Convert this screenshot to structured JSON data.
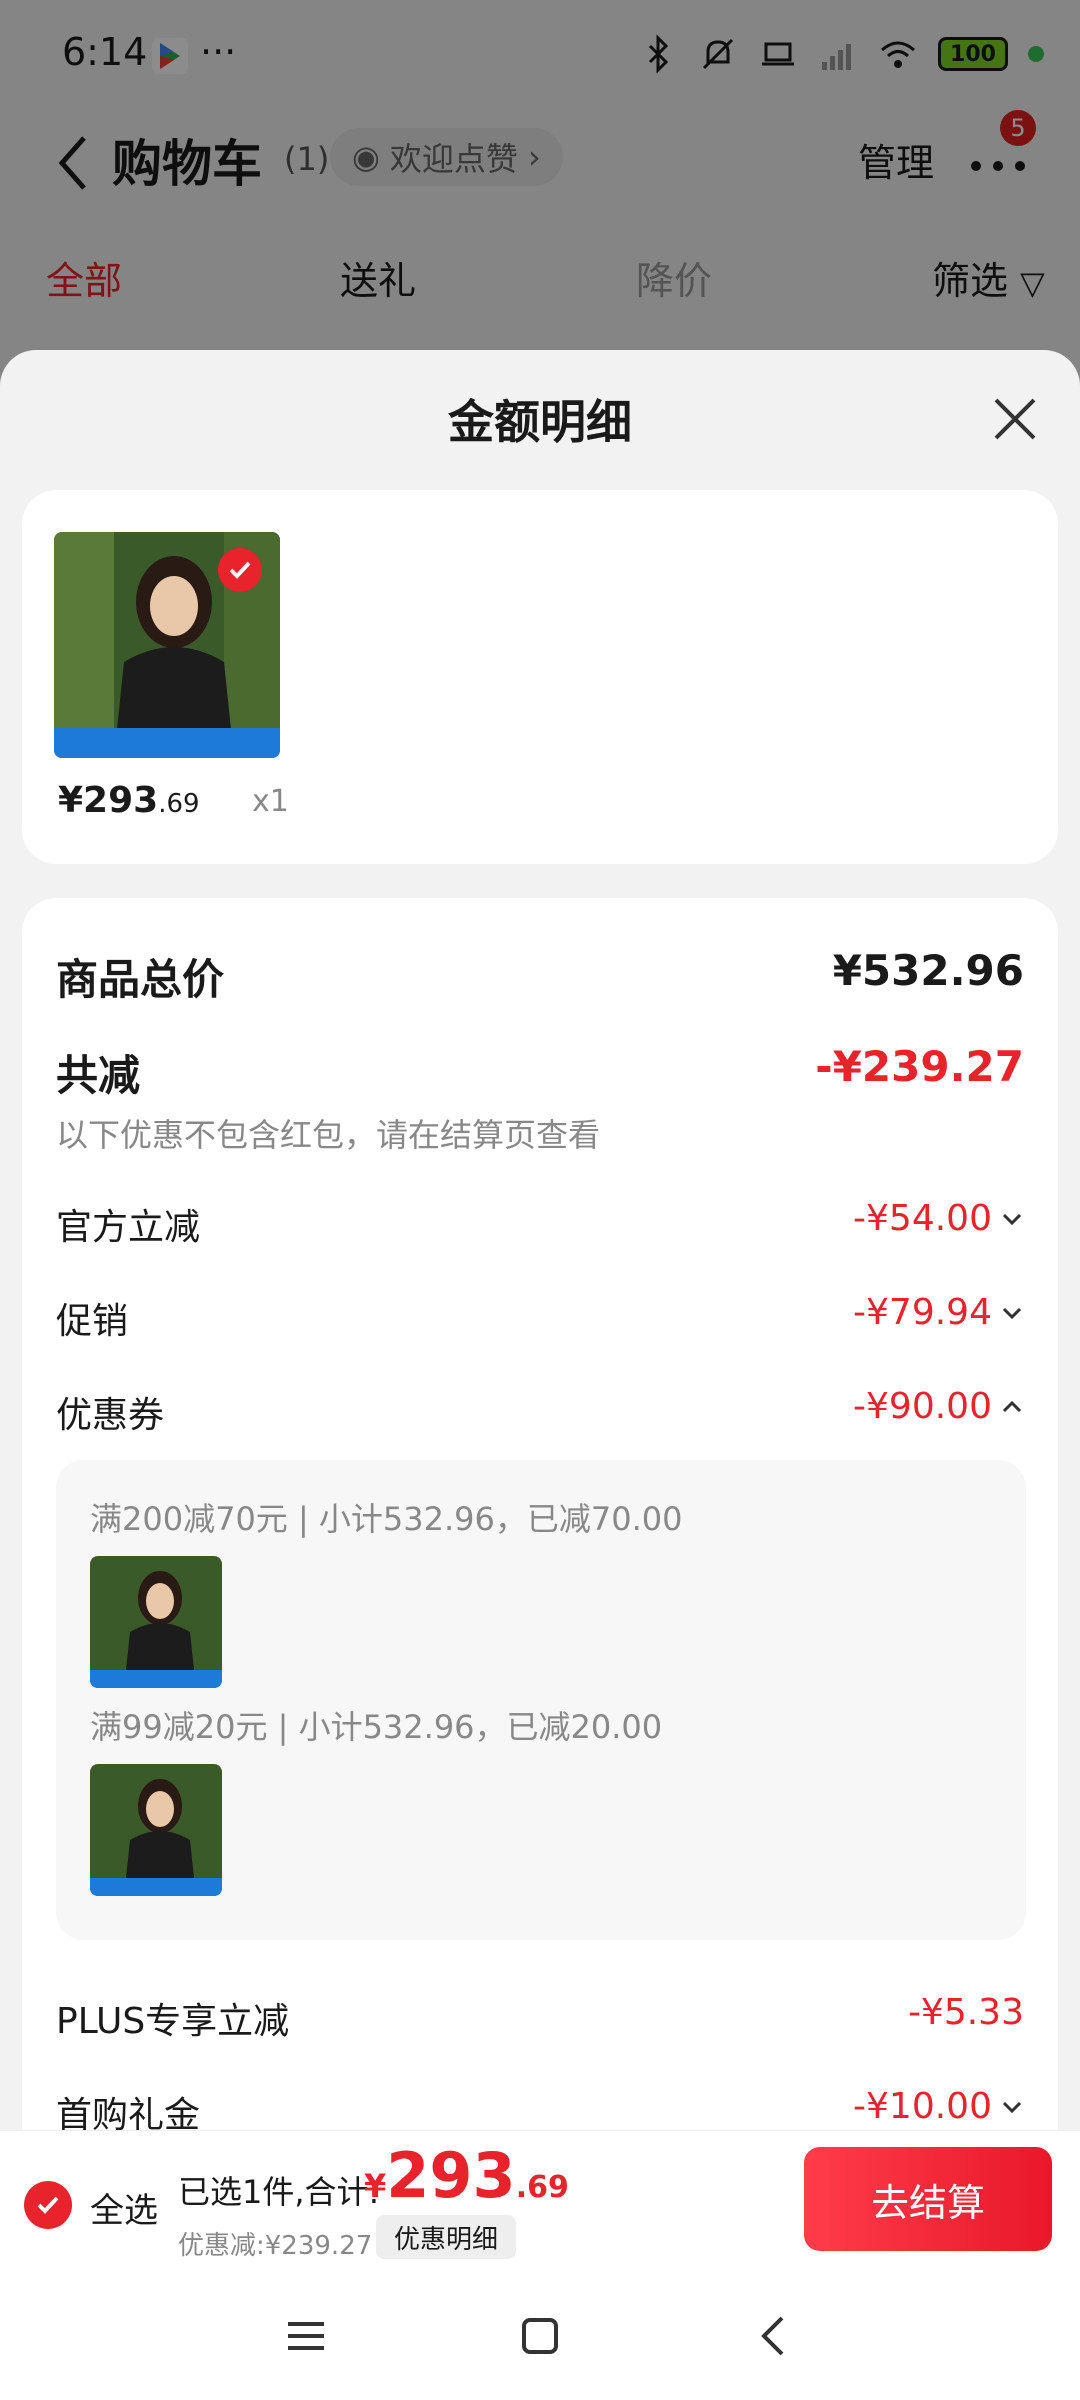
{
  "status_bar": {
    "time": "6:14",
    "dots": "···",
    "battery": "100"
  },
  "header": {
    "back": "<",
    "title": "购物车",
    "count": "(1)",
    "pill": "欢迎点赞",
    "manage": "管理",
    "badge": "5"
  },
  "tabs": [
    {
      "label": "全部",
      "active": true
    },
    {
      "label": "送礼"
    },
    {
      "label": "降价"
    },
    {
      "label": "筛选"
    }
  ],
  "sheet": {
    "title": "金额明细",
    "product": {
      "price_int": "¥293",
      "price_dec": ".69",
      "qty": "x1"
    },
    "total_label": "商品总价",
    "total_value": "¥532.96",
    "discount_label": "共减",
    "discount_value": "-¥239.27",
    "discount_note": "以下优惠不包含红包，请在结算页查看",
    "official_label": "官方立减",
    "official_value": "-¥54.00",
    "promo_label": "促销",
    "promo_value": "-¥79.94",
    "coupon_label": "优惠券",
    "coupon_value": "-¥90.00",
    "coupon_lines": [
      "满200减70元 | 小计532.96，已减70.00",
      "满99减20元 | 小计532.96，已减20.00"
    ],
    "plus_label": "PLUS专享立减",
    "plus_value": "-¥5.33",
    "first_label": "首购礼金",
    "first_value": "-¥10.00"
  },
  "bottom_bar": {
    "select_all": "全选",
    "selected": "已选1件,合计:",
    "currency": "¥",
    "total_int": "293",
    "total_dec": ".69",
    "save": "优惠减:¥239.27",
    "detail": "优惠明细",
    "checkout": "去结算"
  },
  "colors": {
    "accent": "#e8232c"
  }
}
